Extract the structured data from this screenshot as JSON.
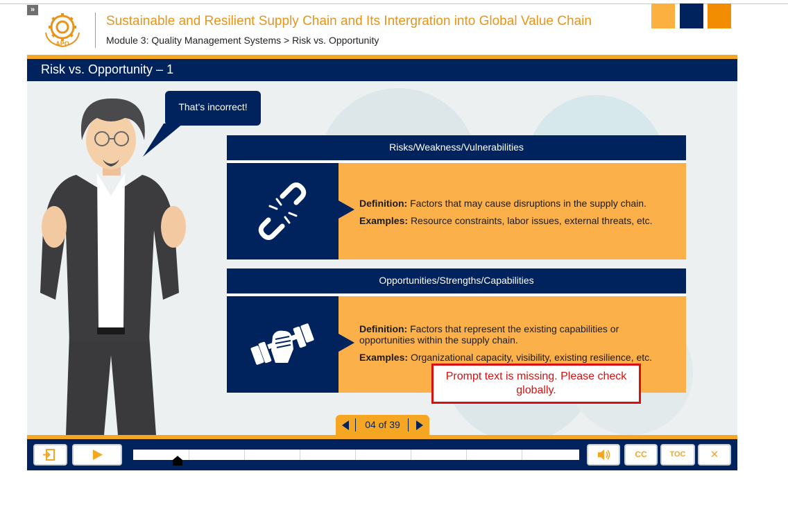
{
  "header": {
    "course_title": "Sustainable and Resilient Supply Chain and Its Intergration into Global Value Chain",
    "breadcrumb": "Module 3: Quality Management Systems > Risk vs. Opportunity",
    "logo_text": "APO",
    "toggle_label": "»",
    "color_squares": [
      "#fbb040",
      "#00235e",
      "#f28c00"
    ]
  },
  "slide": {
    "title": "Risk vs. Opportunity – 1",
    "speech_bubble": "That’s incorrect!",
    "risks": {
      "heading": "Risks/Weakness/Vulnerabilities",
      "icon": "broken-chain-icon",
      "definition_label": "Definition:",
      "definition_text": "Factors that may cause disruptions in the supply chain.",
      "examples_label": "Examples:",
      "examples_text": "Resource constraints, labor issues, external threats, etc."
    },
    "opportunities": {
      "heading": "Opportunities/Strengths/Capabilities",
      "icon": "fist-dumbbell-icon",
      "definition_label": "Definition:",
      "definition_text": "Factors that represent the existing capabilities or opportunities within the supply chain.",
      "examples_label": "Examples:",
      "examples_text": "Organizational capacity, visibility, existing resilience, etc."
    },
    "prompt_warning": "Prompt text is missing. Please check globally."
  },
  "pager": {
    "label": "04 of 39"
  },
  "player": {
    "progress_fraction": 0.1,
    "buttons": {
      "exit_icon": "exit-icon",
      "play_icon": "play-icon",
      "volume_icon": "speaker-icon",
      "cc_label": "CC",
      "toc_label": "TOC",
      "close_label": "✕"
    }
  },
  "colors": {
    "navy": "#00235e",
    "orange": "#f5a623",
    "card": "#fcb04a",
    "warning": "#d81010"
  }
}
